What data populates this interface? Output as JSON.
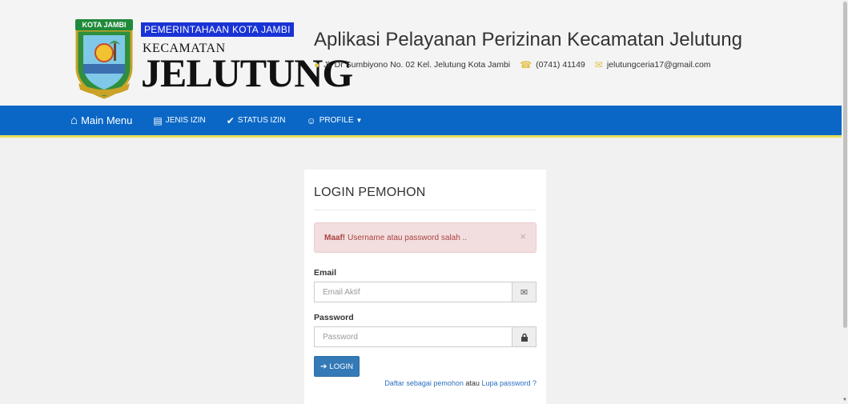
{
  "header": {
    "brand_top": "PEMERINTAHAAN KOTA JAMBI",
    "brand_mid": "KECAMATAN",
    "brand_big": "JELUTUNG",
    "emblem_text": "KOTA JAMBI",
    "app_title": "Aplikasi Pelayanan Perizinan Kecamatan Jelutung",
    "address": "Jl. Dr Sumbiyono No. 02 Kel. Jelutung Kota Jambi",
    "phone": "(0741) 41149",
    "email": "jelutungceria17@gmail.com"
  },
  "nav": {
    "items": [
      {
        "label": "Main Menu",
        "icon": "home-icon"
      },
      {
        "label": "JENIS IZIN",
        "icon": "list-icon"
      },
      {
        "label": "STATUS IZIN",
        "icon": "check-circle-icon"
      },
      {
        "label": "PROFILE",
        "icon": "user-icon"
      }
    ]
  },
  "login": {
    "title": "LOGIN PEMOHON",
    "alert_strong": "Maaf!",
    "alert_text": "Username atau password salah ..",
    "email_label": "Email",
    "email_placeholder": "Email Aktif",
    "password_label": "Password",
    "password_placeholder": "Password",
    "button_label": "LOGIN",
    "register_link": "Daftar sebagai pemohon",
    "or_text": "atau",
    "forgot_link": "Lupa password ?"
  },
  "colors": {
    "navbar": "#0a67c6",
    "nav_accent": "#e7e05a",
    "brand_blue": "#1a33d6",
    "alert_bg": "#f2dede",
    "button": "#337ab7"
  }
}
